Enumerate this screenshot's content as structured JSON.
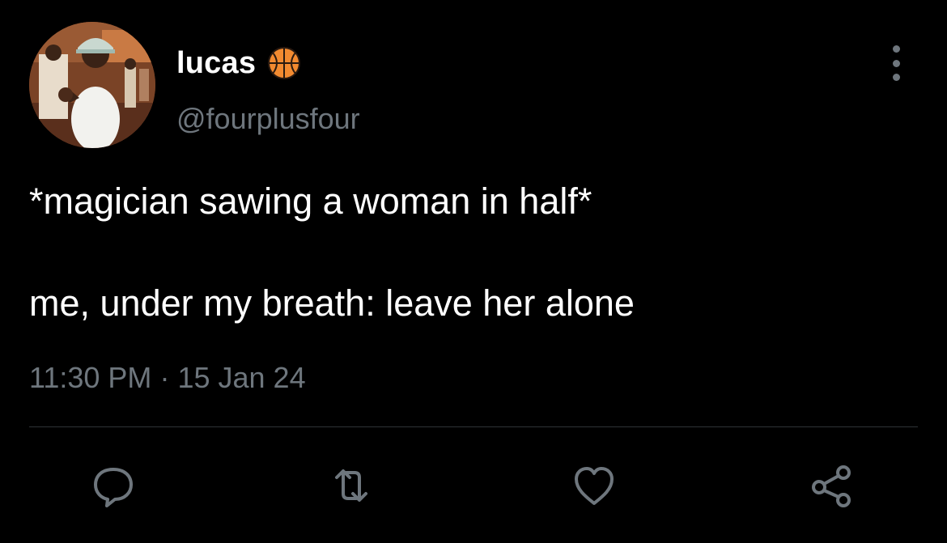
{
  "user": {
    "display_name": "lucas",
    "name_emoji": "basketball-emoji",
    "handle": "@fourplusfour",
    "avatar": "profile-photo"
  },
  "tweet": {
    "line1": "*magician sawing a woman in half*",
    "line2": "me, under my breath: leave her alone",
    "time": "11:30 PM",
    "separator": "·",
    "date": "15 Jan 24"
  },
  "actions": {
    "reply_icon": "comment-icon",
    "retweet_icon": "retweet-icon",
    "like_icon": "heart-icon",
    "share_icon": "share-icon"
  },
  "colors": {
    "background": "#000000",
    "primary_text": "#ffffff",
    "secondary_text": "#6e767d",
    "divider": "#2f3336",
    "basketball": "#f28a30"
  }
}
